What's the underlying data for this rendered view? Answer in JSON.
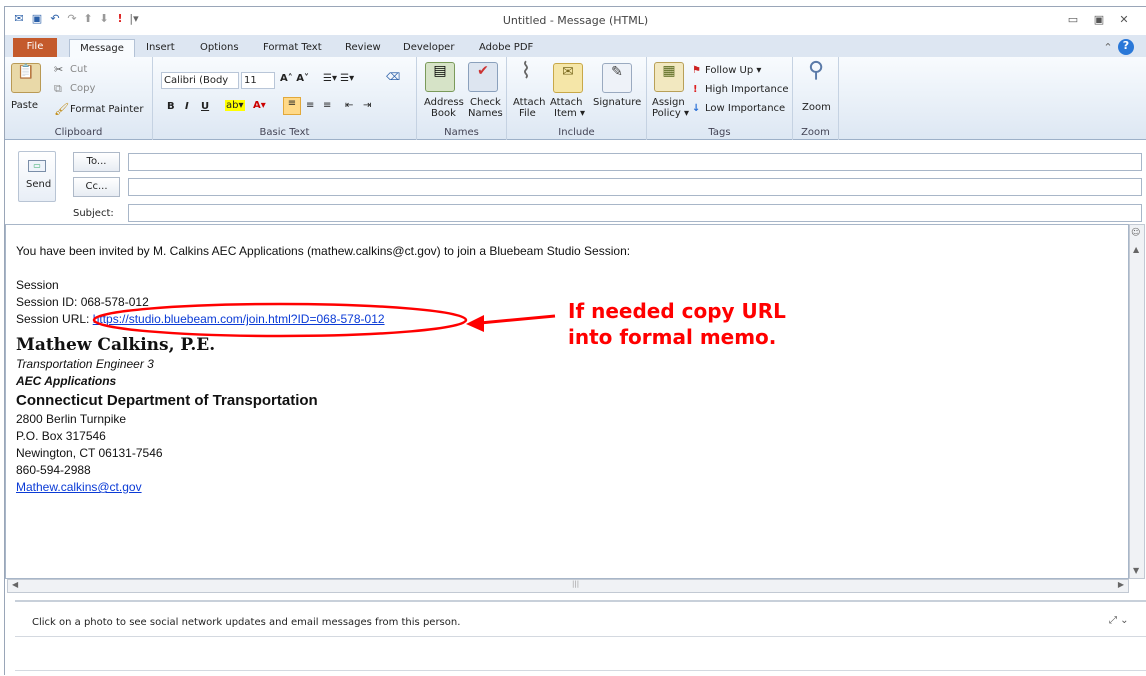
{
  "window": {
    "title": "Untitled  -  Message (HTML)"
  },
  "quickaccess": [
    "outlook-icon",
    "save-icon",
    "undo-icon",
    "redo-icon",
    "up-icon",
    "down-icon",
    "importance-icon",
    "customize-icon"
  ],
  "tabs": [
    "File",
    "Message",
    "Insert",
    "Options",
    "Format Text",
    "Review",
    "Developer",
    "Adobe PDF"
  ],
  "ribbon": {
    "clipboard": {
      "paste": "Paste",
      "cut": "Cut",
      "copy": "Copy",
      "painter": "Format Painter",
      "label": "Clipboard"
    },
    "basic_text": {
      "font": "Calibri (Body",
      "size": "11",
      "label": "Basic Text"
    },
    "names": {
      "address_book_1": "Address",
      "address_book_2": "Book",
      "check_names_1": "Check",
      "check_names_2": "Names",
      "label": "Names"
    },
    "include": {
      "attach_file_1": "Attach",
      "attach_file_2": "File",
      "attach_item_1": "Attach",
      "attach_item_2": "Item ▾",
      "signature": "Signature",
      "label": "Include"
    },
    "tags": {
      "assign_1": "Assign",
      "assign_2": "Policy ▾",
      "follow_up": "Follow Up ▾",
      "high": "High Importance",
      "low": "Low Importance",
      "label": "Tags"
    },
    "zoom": {
      "button": "Zoom",
      "label": "Zoom"
    }
  },
  "compose": {
    "send": "Send",
    "to": "To...",
    "cc": "Cc...",
    "subject": "Subject:"
  },
  "body": {
    "invite": "You have been invited by M. Calkins AEC Applications (mathew.calkins@ct.gov) to join a Bluebeam Studio Session:",
    "session": "Session",
    "session_id": "Session ID: 068-578-012",
    "session_url_label": "Session URL: ",
    "session_url": "https://studio.bluebeam.com/join.html?ID=068-578-012",
    "sig_name": "Mathew Calkins, P.E.",
    "sig_title": "Transportation Engineer 3",
    "sig_group": "AEC Applications",
    "sig_org": "Connecticut Department of Transportation",
    "addr1": "2800 Berlin Turnpike",
    "addr2": "P.O. Box 317546",
    "addr3": "Newington, CT 06131-7546",
    "phone": "860-594-2988",
    "email": "Mathew.calkins@ct.gov"
  },
  "annotation": {
    "line1": "If needed copy URL",
    "line2": "into formal memo.",
    "color": "#ff0000"
  },
  "people_pane": {
    "text": "Click on a photo to see social network updates and email messages from this person."
  }
}
